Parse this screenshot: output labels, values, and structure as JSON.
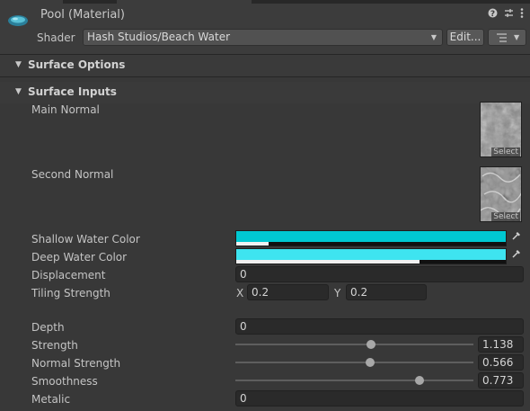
{
  "header": {
    "title": "Pool (Material)",
    "shader_label": "Shader",
    "shader_value": "Hash Studios/Beach Water",
    "edit_label": "Edit...",
    "icons": [
      "help-icon",
      "preset-icon",
      "more-icon"
    ]
  },
  "sections": {
    "surface_options": "Surface Options",
    "surface_inputs": "Surface Inputs"
  },
  "properties": {
    "main_normal": {
      "label": "Main Normal",
      "select": "Select"
    },
    "second_normal": {
      "label": "Second Normal",
      "select": "Select"
    },
    "shallow_water_color": {
      "label": "Shallow Water Color",
      "color": "#00c8d2",
      "alpha": 0.12
    },
    "deep_water_color": {
      "label": "Deep Water Color",
      "color": "#3ee4f0",
      "alpha": 0.68
    },
    "displacement": {
      "label": "Displacement",
      "value": "0"
    },
    "tiling_strength": {
      "label": "Tiling Strength",
      "x_label": "X",
      "x_value": "0.2",
      "y_label": "Y",
      "y_value": "0.2"
    },
    "depth": {
      "label": "Depth",
      "value": "0"
    },
    "strength": {
      "label": "Strength",
      "value": "1.138",
      "fraction": 0.57
    },
    "normal_strength": {
      "label": "Normal Strength",
      "value": "0.566",
      "fraction": 0.566
    },
    "smoothness": {
      "label": "Smoothness",
      "value": "0.773",
      "fraction": 0.773
    },
    "metalic": {
      "label": "Metalic",
      "value": "0"
    }
  }
}
